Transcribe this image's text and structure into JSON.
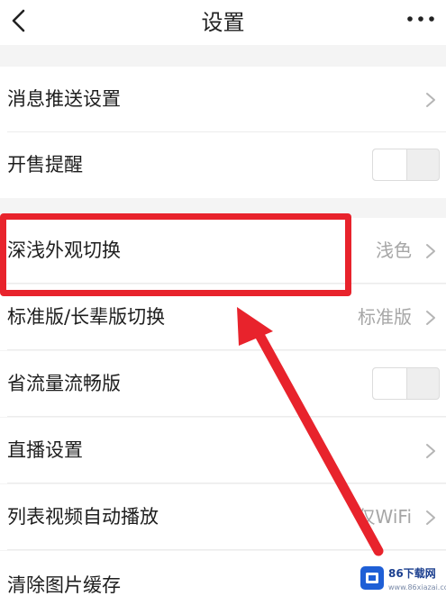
{
  "header": {
    "title": "设置"
  },
  "settings": {
    "push_notifications": {
      "label": "消息推送设置"
    },
    "sale_reminder": {
      "label": "开售提醒",
      "enabled": false
    },
    "appearance": {
      "label": "深浅外观切换",
      "value": "浅色"
    },
    "version_mode": {
      "label": "标准版/长辈版切换",
      "value": "标准版"
    },
    "data_saver": {
      "label": "省流量流畅版",
      "enabled": false
    },
    "live_settings": {
      "label": "直播设置"
    },
    "autoplay": {
      "label": "列表视频自动播放",
      "value": "仅WiFi"
    },
    "clear_cache": {
      "label": "清除图片缓存"
    }
  },
  "annotation": {
    "color": "#e8232c"
  },
  "watermark": {
    "brand": "86下载网",
    "url": "www.86xiazai.com"
  }
}
